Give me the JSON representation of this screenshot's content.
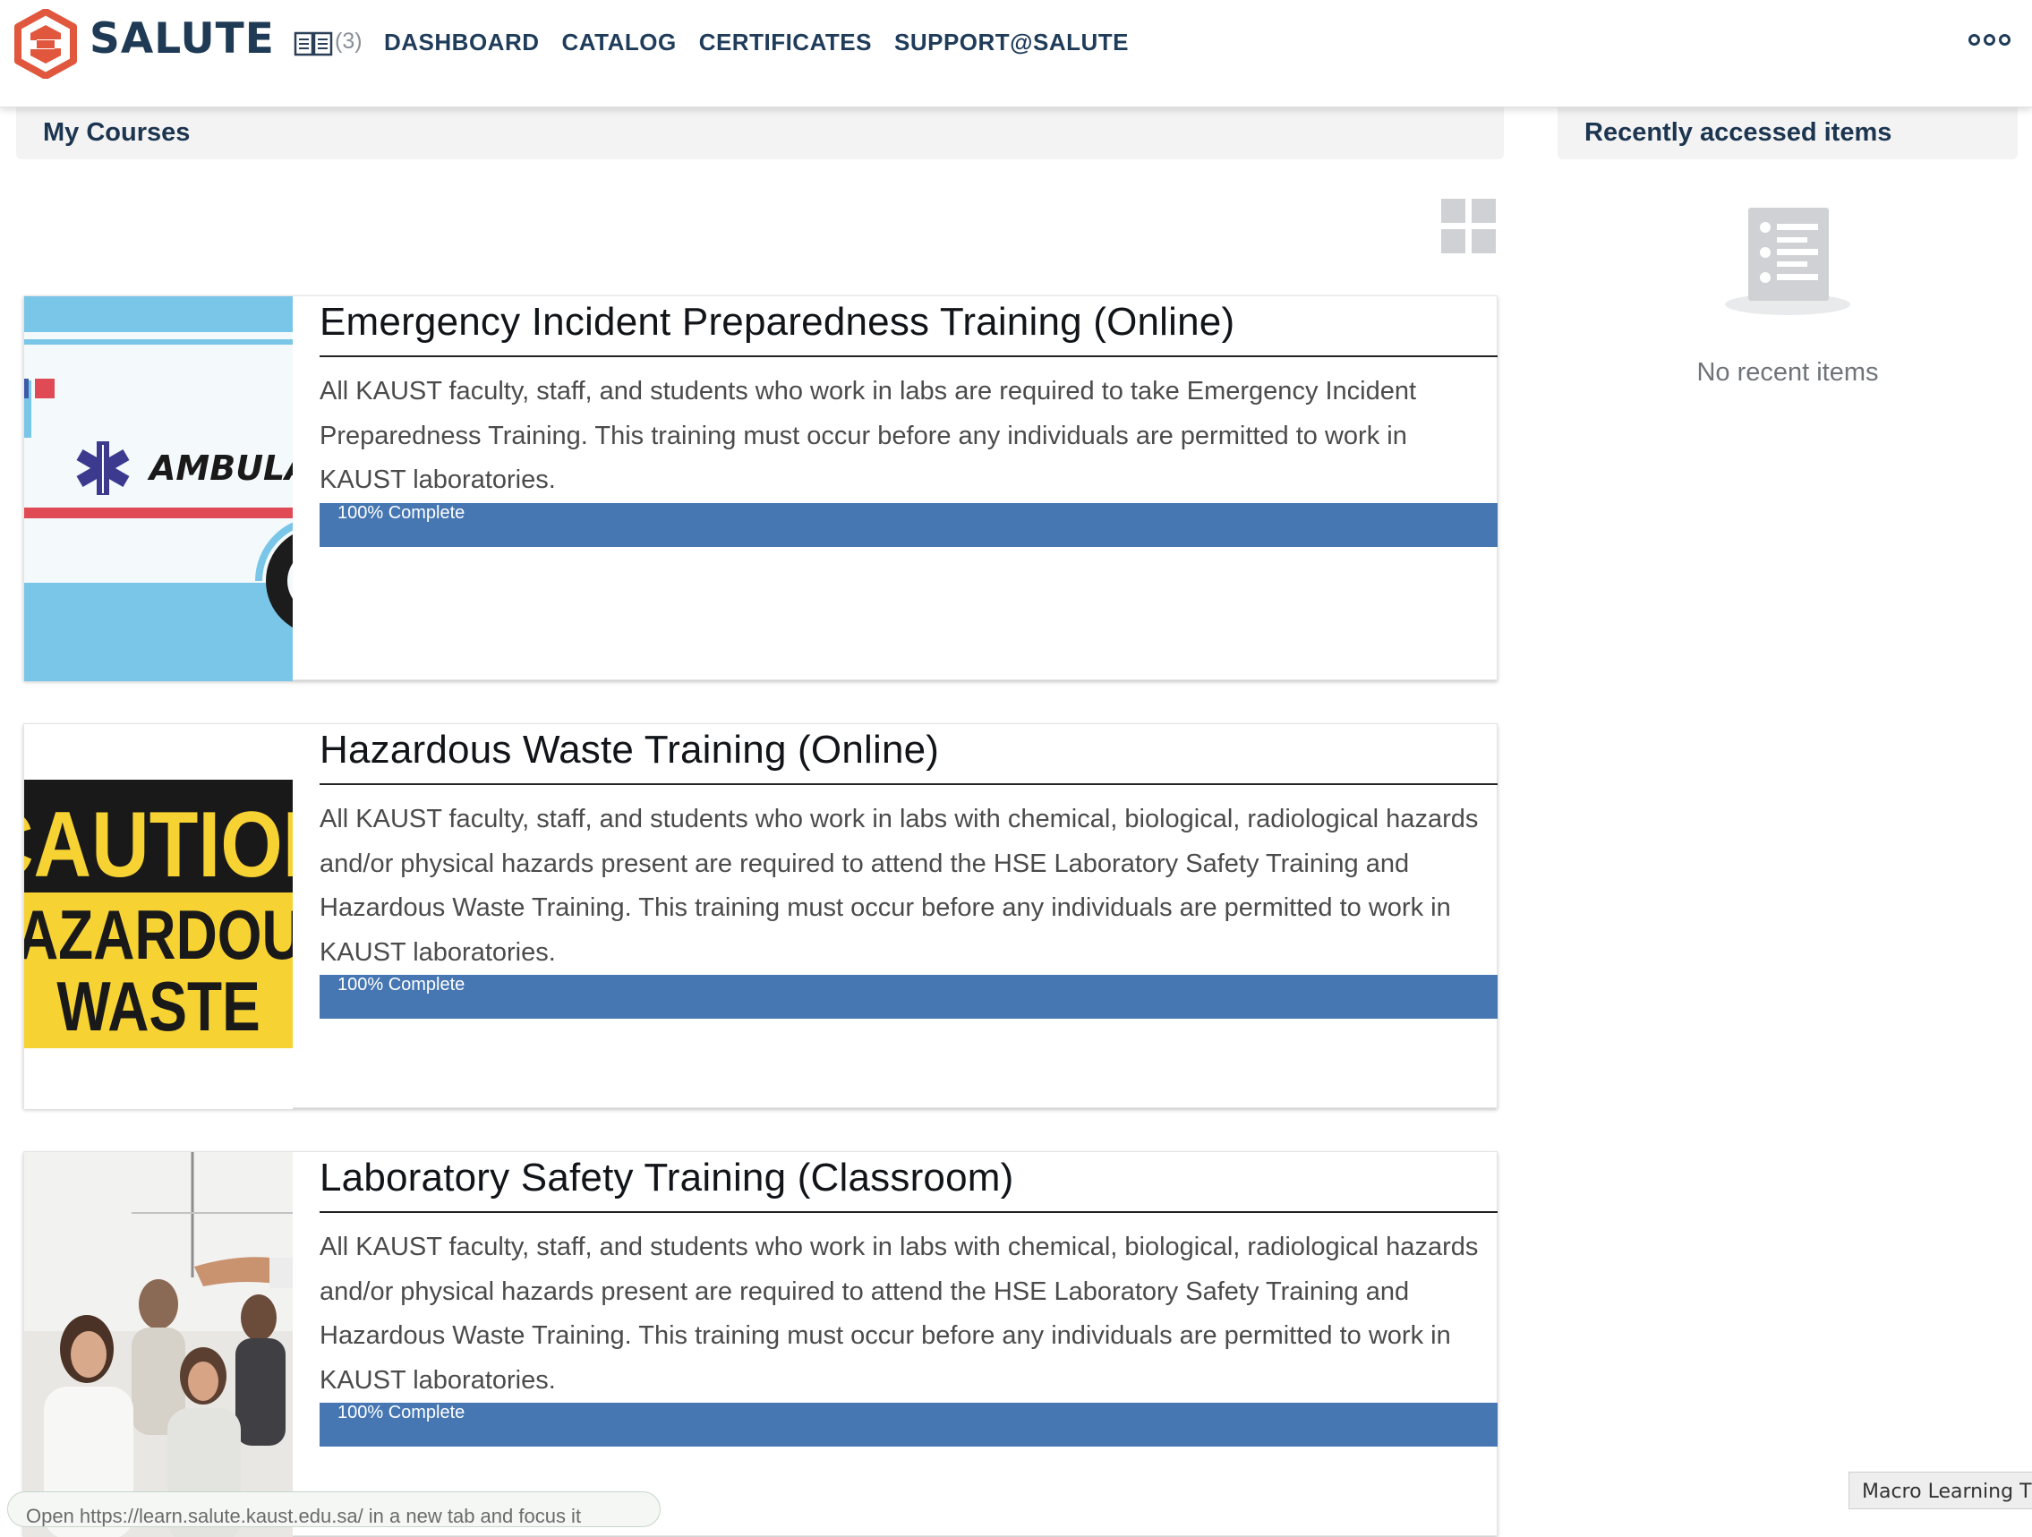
{
  "brand": {
    "name": "SALUTE",
    "accent_color": "#e0573d",
    "text_color": "#1e3a55"
  },
  "nav": {
    "book_icon": "book-icon",
    "cart_count": "(3)",
    "links": [
      "DASHBOARD",
      "CATALOG",
      "CERTIFICATES",
      "SUPPORT@SALUTE"
    ],
    "more_icon": "ooo"
  },
  "my_courses": {
    "title": "My Courses",
    "view_toggle_icon": "grid-icon"
  },
  "courses": [
    {
      "title": "Emergency Incident Preparedness Training (Online)",
      "description": "All KAUST faculty, staff, and students who work in labs are required to take Emergency Incident Preparedness Training. This training must occur before any individuals are permitted to work in KAUST laboratories.",
      "progress_percent": 100,
      "progress_label": "100% Complete",
      "thumbnail": "ambulance",
      "thumbnail_text": "AMBULANCE"
    },
    {
      "title": "Hazardous Waste Training (Online)",
      "description": "All KAUST faculty, staff, and students who work in labs with chemical, biological, radiological hazards and/or physical hazards present are required to attend the HSE Laboratory Safety Training and Hazardous Waste Training. This training must occur before any individuals are permitted to work in KAUST laboratories.",
      "progress_percent": 100,
      "progress_label": "100% Complete",
      "thumbnail": "caution-sign",
      "thumbnail_lines": [
        "CAUTION",
        "HAZARDOUS",
        "WASTE"
      ]
    },
    {
      "title": "Laboratory Safety Training (Classroom)",
      "description": "All KAUST faculty, staff, and students who work in labs with chemical, biological, radiological hazards and/or physical hazards present are required to attend the HSE Laboratory Safety Training and Hazardous Waste Training. This training must occur before any individuals are permitted to work in KAUST laboratories.",
      "progress_percent": 100,
      "progress_label": "100% Complete",
      "thumbnail": "classroom-photo"
    }
  ],
  "recent": {
    "title": "Recently accessed items",
    "empty_text": "No recent items",
    "icon": "list-icon"
  },
  "footer": {
    "status_url": "Open https://learn.salute.kaust.edu.sa/ in a new tab and focus it",
    "macro_badge": "Macro Learning Tl"
  },
  "colors": {
    "progress_bar": "#4677b2",
    "header_bg": "#f3f3f3"
  }
}
